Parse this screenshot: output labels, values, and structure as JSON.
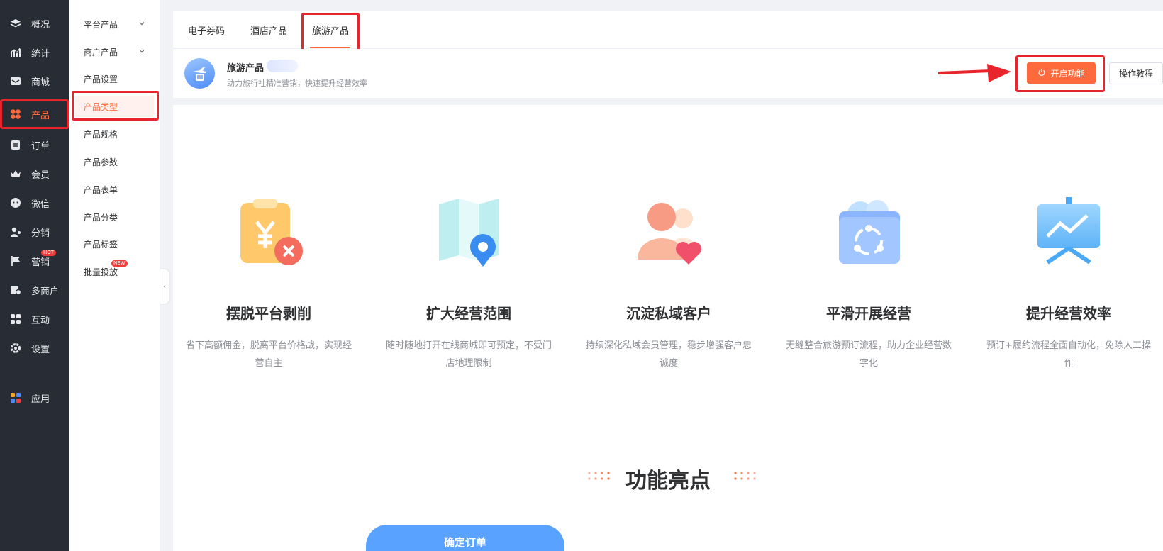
{
  "sidebar": {
    "items": [
      {
        "label": "概况",
        "icon": "layers-icon"
      },
      {
        "label": "统计",
        "icon": "chart-icon"
      },
      {
        "label": "商城",
        "icon": "mail-icon"
      },
      {
        "label": "产品",
        "icon": "clover-icon"
      },
      {
        "label": "订单",
        "icon": "clipboard-icon"
      },
      {
        "label": "会员",
        "icon": "crown-icon"
      },
      {
        "label": "微信",
        "icon": "chat-icon"
      },
      {
        "label": "分销",
        "icon": "user-share-icon"
      },
      {
        "label": "营销",
        "icon": "flag-icon",
        "badge": "HOT"
      },
      {
        "label": "多商户",
        "icon": "store-icon"
      },
      {
        "label": "互动",
        "icon": "grid-icon"
      },
      {
        "label": "设置",
        "icon": "gear-icon"
      },
      {
        "label": "应用",
        "icon": "apps-icon"
      }
    ]
  },
  "submenu": {
    "items": [
      {
        "label": "平台产品"
      },
      {
        "label": "商户产品"
      },
      {
        "label": "产品设置"
      },
      {
        "label": "产品类型"
      },
      {
        "label": "产品规格"
      },
      {
        "label": "产品参数"
      },
      {
        "label": "产品表单"
      },
      {
        "label": "产品分类"
      },
      {
        "label": "产品标签"
      },
      {
        "label": "批量投放",
        "badge": "NEW"
      }
    ]
  },
  "tabs": [
    {
      "label": "电子券码"
    },
    {
      "label": "酒店产品"
    },
    {
      "label": "旅游产品"
    }
  ],
  "product": {
    "title": "旅游产品",
    "description": "助力旅行社精准营销，快速提升经营效率",
    "enable_label": "开启功能",
    "tutorial_label": "操作教程"
  },
  "features": [
    {
      "title": "摆脱平台剥削",
      "desc": "省下高额佣金，脱离平台价格战，实现经营自主"
    },
    {
      "title": "扩大经营范围",
      "desc": "随时随地打开在线商城即可预定，不受门店地理限制"
    },
    {
      "title": "沉淀私域客户",
      "desc": "持续深化私域会员管理，稳步增强客户忠诚度"
    },
    {
      "title": "平滑开展经营",
      "desc": "无缝整合旅游预订流程，助力企业经营数字化"
    },
    {
      "title": "提升经营效率",
      "desc": "预订+履约流程全面自动化，免除人工操作"
    }
  ],
  "highlights": {
    "title": "功能亮点",
    "confirm_label": "确定订单"
  },
  "colors": {
    "accent": "#ff6a3d",
    "sidebar_bg": "#282c34",
    "annotation_red": "#e8242c"
  }
}
